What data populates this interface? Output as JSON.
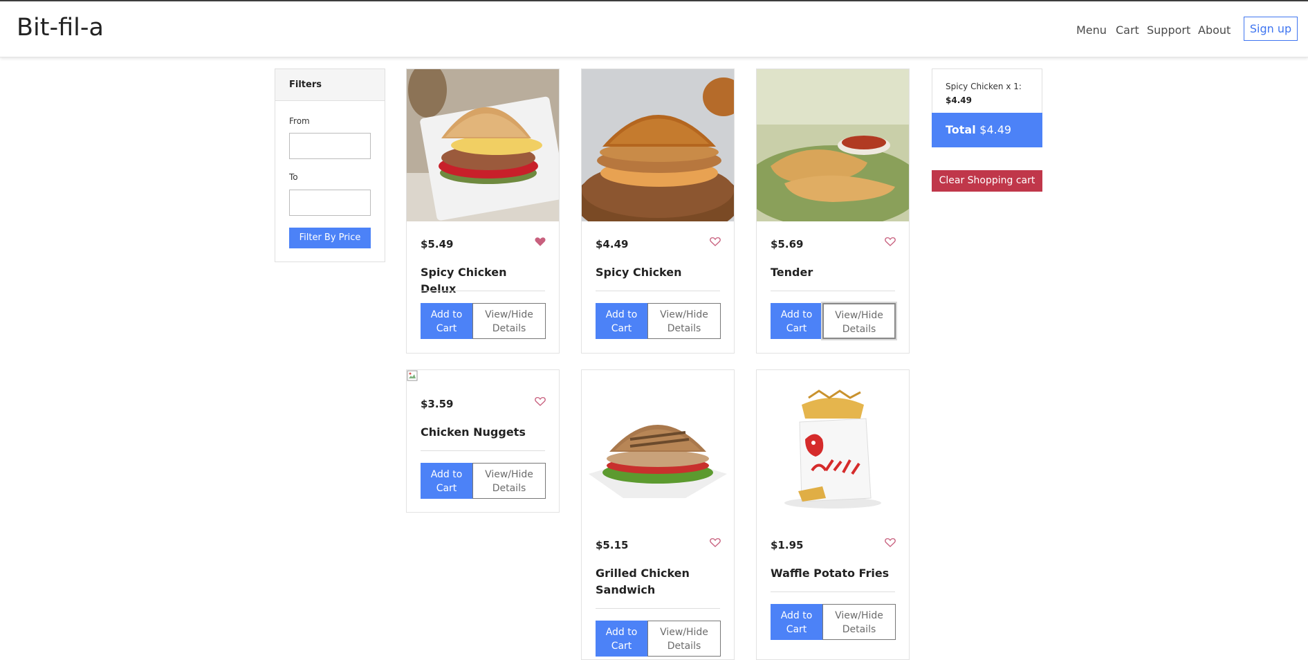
{
  "header": {
    "brand": "Bit-fil-a",
    "nav": [
      "Menu",
      "Cart",
      "Support",
      "About"
    ],
    "signup_label": "Sign up"
  },
  "filters": {
    "title": "Filters",
    "from_label": "From",
    "to_label": "To",
    "from_value": "",
    "to_value": "",
    "button_label": "Filter By Price"
  },
  "products": [
    {
      "price": "$5.49",
      "name": "Spicy Chicken Delux",
      "favorited": true,
      "add_label": "Add to Cart",
      "view_label": "View/Hide Details",
      "image": "spicy-chicken-delux-photo"
    },
    {
      "price": "$4.49",
      "name": "Spicy Chicken",
      "favorited": false,
      "add_label": "Add to Cart",
      "view_label": "View/Hide Details",
      "image": "spicy-chicken-photo"
    },
    {
      "price": "$5.69",
      "name": "Tender",
      "favorited": false,
      "add_label": "Add to Cart",
      "view_label": "View/Hide Details",
      "image": "tender-photo"
    },
    {
      "price": "$3.59",
      "name": "Chicken Nuggets",
      "favorited": false,
      "add_label": "Add to Cart",
      "view_label": "View/Hide Details",
      "image": "broken-image"
    },
    {
      "price": "$5.15",
      "name": "Grilled Chicken Sandwich",
      "favorited": false,
      "add_label": "Add to Cart",
      "view_label": "View/Hide Details",
      "image": "grilled-chicken-sandwich-photo"
    },
    {
      "price": "$1.95",
      "name": "Waffle Potato Fries",
      "favorited": false,
      "add_label": "Add to Cart",
      "view_label": "View/Hide Details",
      "image": "waffle-fries-photo"
    }
  ],
  "cart": {
    "item_line": "Spicy Chicken x 1:",
    "item_price": "$4.49",
    "total_label": "Total",
    "total_value": "$4.49",
    "clear_label": "Clear Shopping cart"
  },
  "colors": {
    "accent": "#4c82f7",
    "danger": "#c0374a",
    "heart": "#c8607e"
  }
}
